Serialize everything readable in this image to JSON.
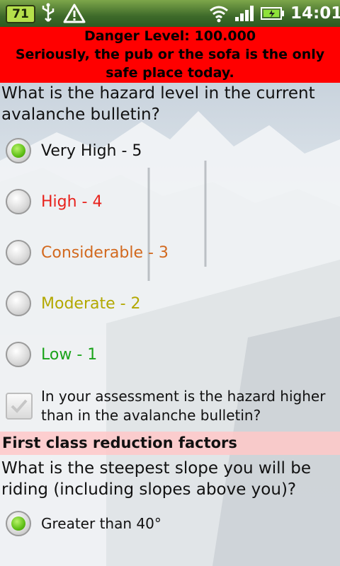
{
  "status_bar": {
    "battery_badge": "71",
    "time": "14:01",
    "icons": [
      "usb-icon",
      "warning-icon",
      "wifi-icon",
      "signal-icon",
      "battery-icon"
    ]
  },
  "banner": {
    "title": "Danger Level: 100.000",
    "message": "Seriously, the pub or the sofa is the only safe place today.",
    "color": "#ff0000"
  },
  "question1": {
    "text": "What is the hazard level in the current avalanche bulletin?",
    "options": [
      {
        "label": "Very High - 5",
        "color": "#111111",
        "checked": true
      },
      {
        "label": "High - 4",
        "color": "#e8231d",
        "checked": false
      },
      {
        "label": "Considerable - 3",
        "color": "#d2691e",
        "checked": false
      },
      {
        "label": "Moderate - 2",
        "color": "#b3a800",
        "checked": false
      },
      {
        "label": "Low - 1",
        "color": "#1aa31a",
        "checked": false
      }
    ]
  },
  "checkbox": {
    "label": "In your assessment is the hazard higher than in the avalanche bulletin?",
    "checked": true
  },
  "section_header": "First class reduction factors",
  "question2": {
    "text": "What is the steepest slope you will be riding (including slopes above you)?",
    "options": [
      {
        "label": "Greater than 40°",
        "checked": true
      }
    ]
  }
}
